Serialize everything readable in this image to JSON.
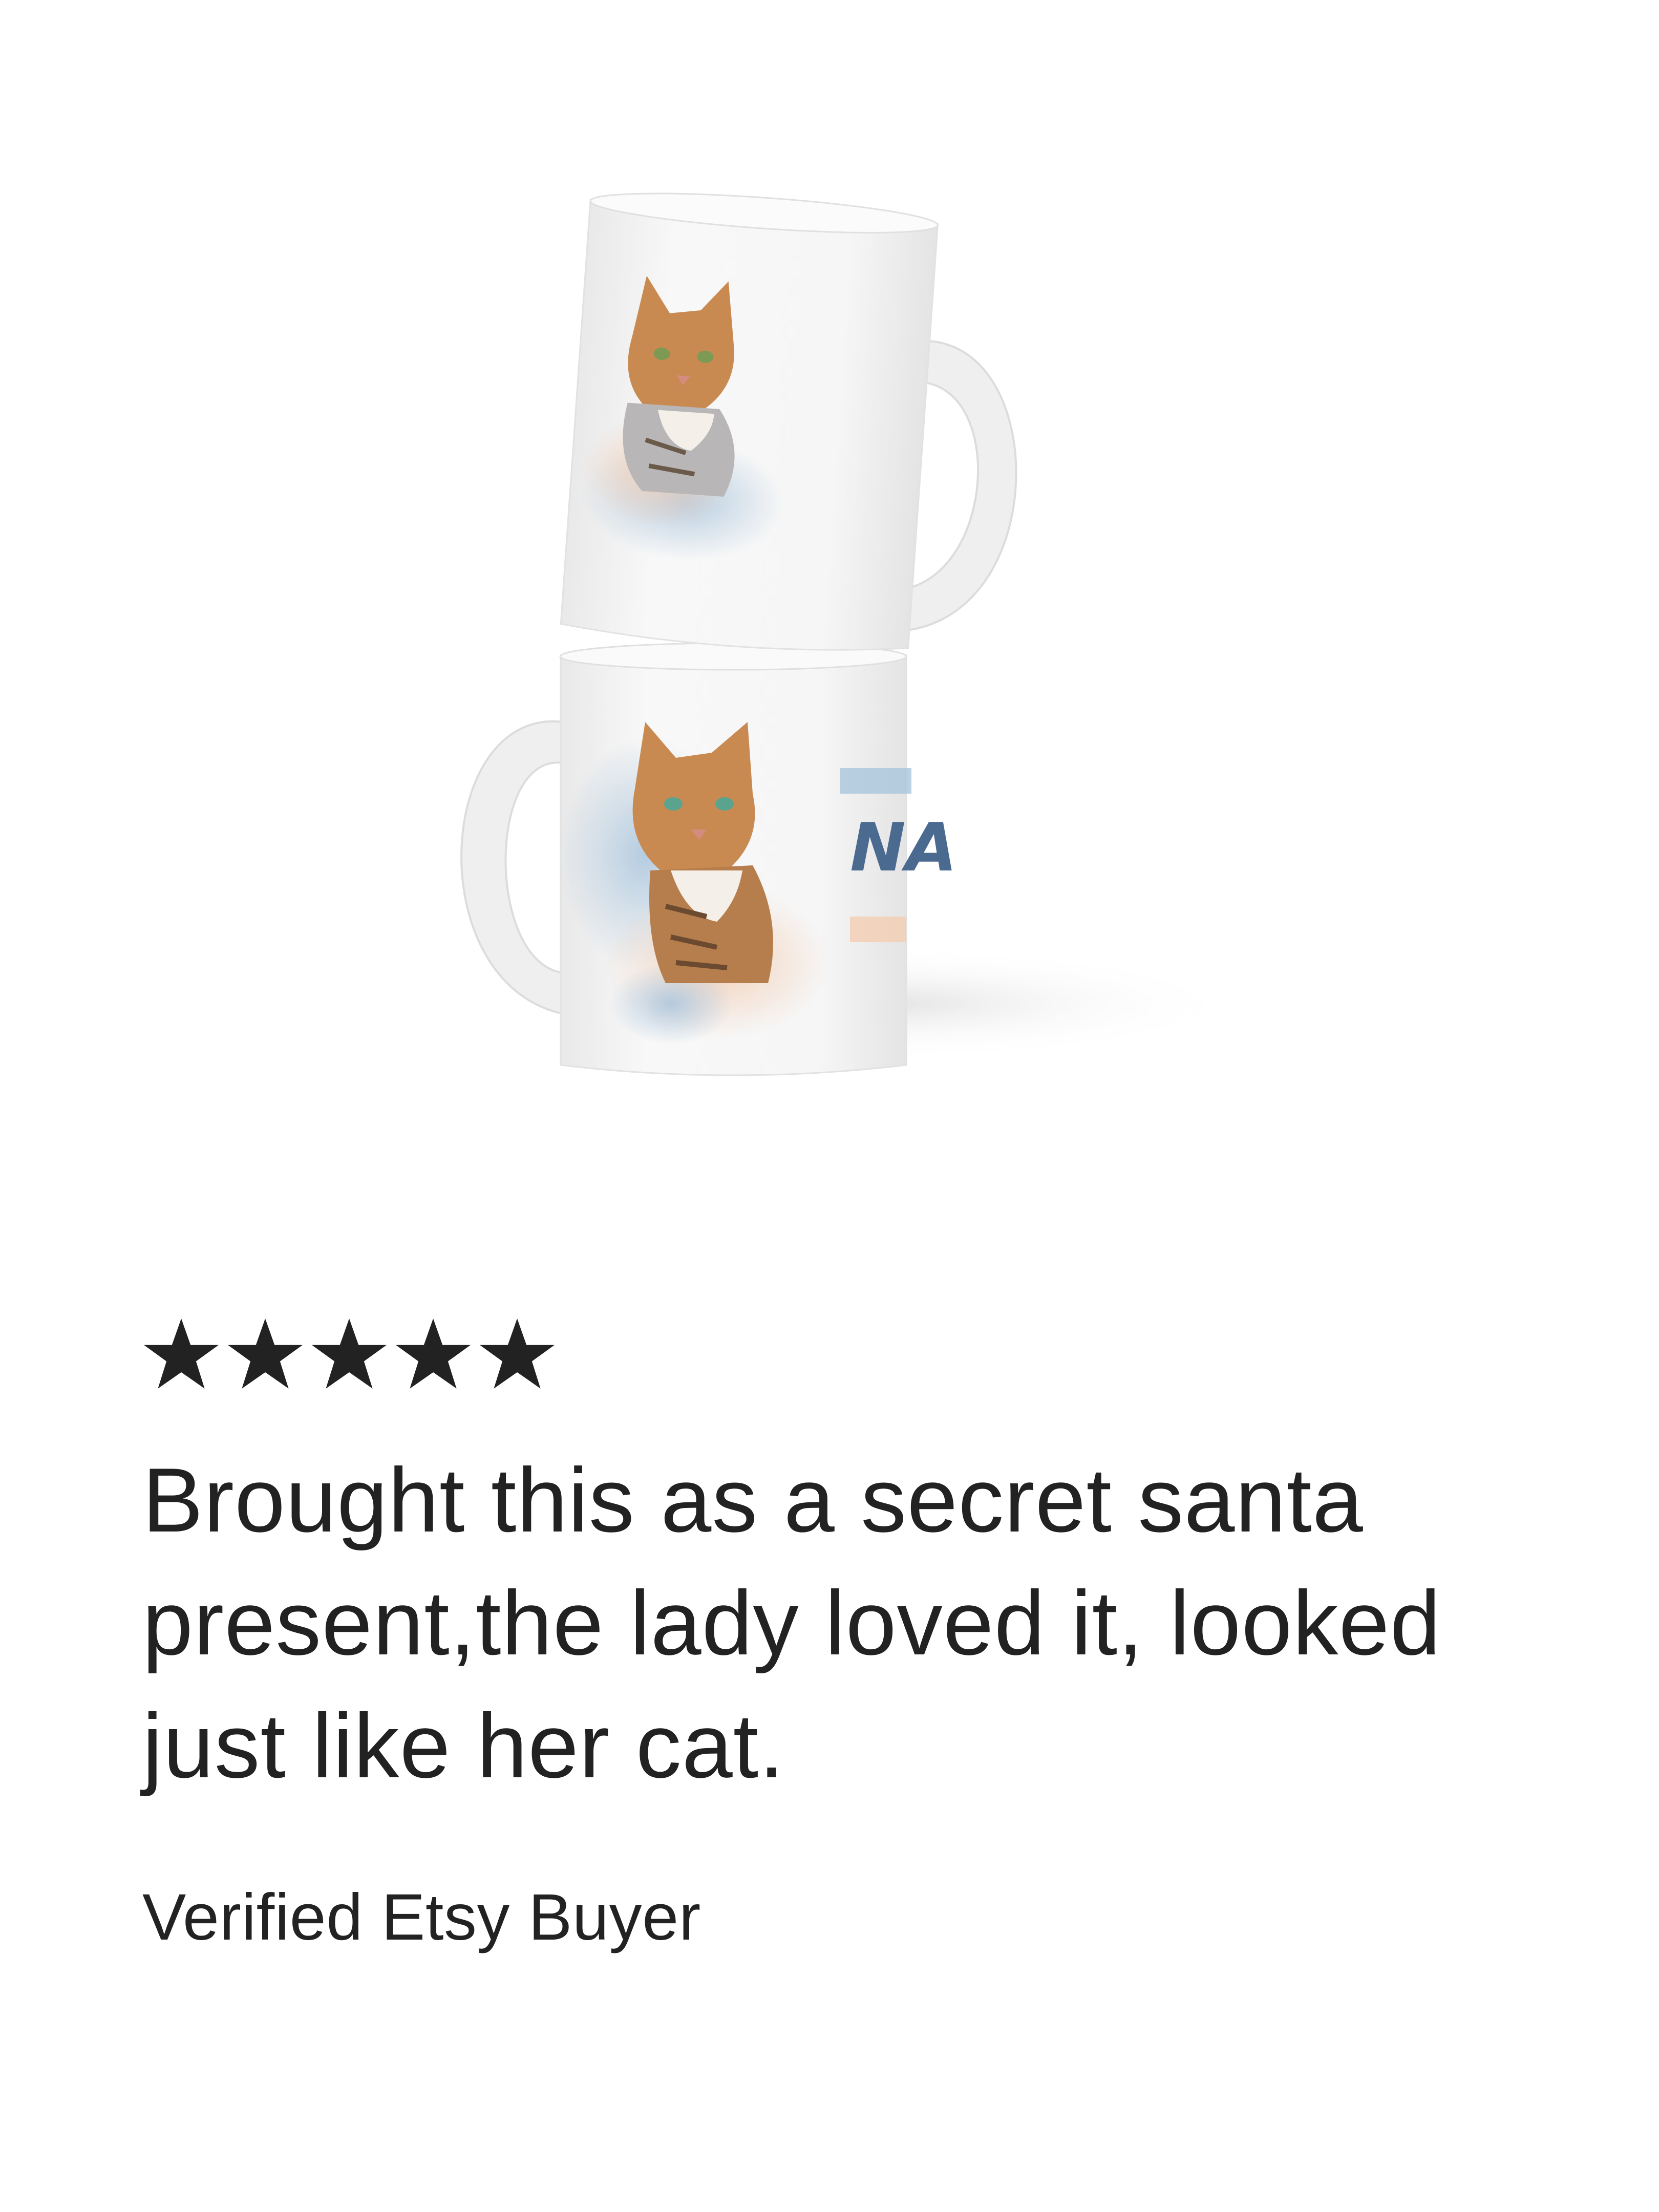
{
  "product": {
    "image_alt": "mug-photo",
    "mug_text": "NA",
    "colors": {
      "mug": "#f4f4f4",
      "shadow": "#e8e8e8",
      "watercolor_blue": "#a9c4dc",
      "watercolor_peach": "#f2cdb3",
      "cat_orange": "#c98a52",
      "text_blue": "#4a6a90"
    }
  },
  "review": {
    "rating": 5,
    "rating_max": 5,
    "star_color": "#222222",
    "text": "Brought this as a secret santa present,the lady loved it, looked just like her cat.",
    "reviewer": "Verified Etsy Buyer"
  }
}
